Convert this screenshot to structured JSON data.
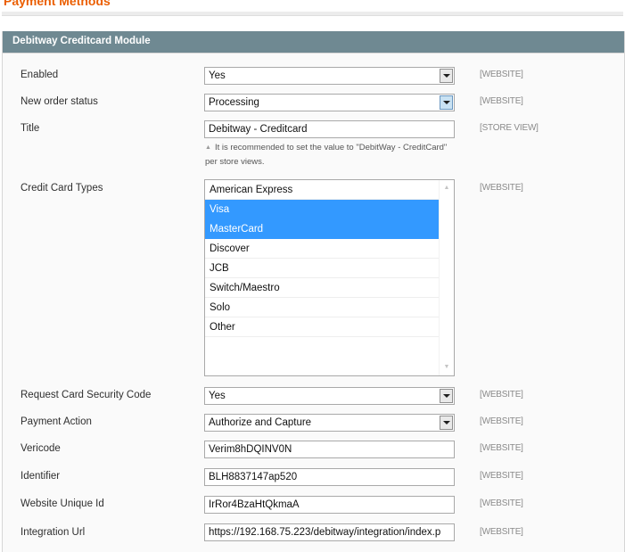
{
  "page": {
    "title": "Payment Methods"
  },
  "section": {
    "title": "Debitway Creditcard Module"
  },
  "fields": {
    "enabled": {
      "label": "Enabled",
      "value": "Yes",
      "scope": "[WEBSITE]"
    },
    "new_order_status": {
      "label": "New order status",
      "value": "Processing",
      "scope": "[WEBSITE]"
    },
    "title": {
      "label": "Title",
      "value": "Debitway - Creditcard",
      "scope": "[STORE VIEW]",
      "note": "It is recommended to set the value to \"DebitWay - CreditCard\" per store views."
    },
    "cc_types": {
      "label": "Credit Card Types",
      "scope": "[WEBSITE]",
      "options": [
        {
          "label": "American Express",
          "selected": false
        },
        {
          "label": "Visa",
          "selected": true
        },
        {
          "label": "MasterCard",
          "selected": true
        },
        {
          "label": "Discover",
          "selected": false
        },
        {
          "label": "JCB",
          "selected": false
        },
        {
          "label": "Switch/Maestro",
          "selected": false
        },
        {
          "label": "Solo",
          "selected": false
        },
        {
          "label": "Other",
          "selected": false
        }
      ]
    },
    "request_csc": {
      "label": "Request Card Security Code",
      "value": "Yes",
      "scope": "[WEBSITE]"
    },
    "payment_action": {
      "label": "Payment Action",
      "value": "Authorize and Capture",
      "scope": "[WEBSITE]"
    },
    "vericode": {
      "label": "Vericode",
      "value": "Verim8hDQINV0N",
      "scope": "[WEBSITE]"
    },
    "identifier": {
      "label": "Identifier",
      "value": "BLH8837147ap520",
      "scope": "[WEBSITE]"
    },
    "website_uid": {
      "label": "Website Unique Id",
      "value": "IrRor4BzaHtQkmaA",
      "scope": "[WEBSITE]"
    },
    "integration_url": {
      "label": "Integration Url",
      "value": "https://192.168.75.223/debitway/integration/index.p",
      "scope": "[WEBSITE]"
    }
  },
  "icons": {
    "dropdown": "chevron-down-icon",
    "note": "triangle-up-icon",
    "scroll_up": "scroll-up-arrow-icon",
    "scroll_down": "scroll-down-arrow-icon"
  },
  "colors": {
    "page_title": "#eb5e00",
    "section_header_bg": "#6f8992",
    "selected_option_bg": "#3399ff"
  }
}
